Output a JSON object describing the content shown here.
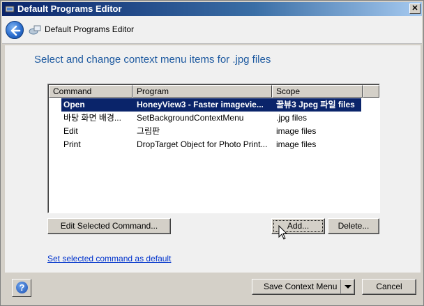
{
  "window": {
    "title": "Default Programs Editor"
  },
  "navbar": {
    "title": "Default Programs Editor"
  },
  "heading": "Select and change context menu items for .jpg files",
  "list": {
    "columns": [
      "Command",
      "Program",
      "Scope"
    ],
    "rows": [
      {
        "command": "Open",
        "program": "HoneyView3 - Faster imagevie...",
        "scope": "꿀뷰3 Jpeg 파일 files",
        "selected": true
      },
      {
        "command": "바탕 화면 배경...",
        "program": "SetBackgroundContextMenu",
        "scope": ".jpg files",
        "selected": false
      },
      {
        "command": "Edit",
        "program": "그림판",
        "scope": "image files",
        "selected": false
      },
      {
        "command": "Print",
        "program": "DropTarget Object for Photo Print...",
        "scope": "image files",
        "selected": false
      }
    ]
  },
  "buttons": {
    "edit": "Edit Selected Command...",
    "add": "Add...",
    "delete": "Delete...",
    "save": "Save Context Menu",
    "cancel": "Cancel"
  },
  "link": "Set selected command as default",
  "colors": {
    "accent": "#1e5aa0",
    "selection": "#0a246a",
    "titlebar": "#0a246a"
  }
}
